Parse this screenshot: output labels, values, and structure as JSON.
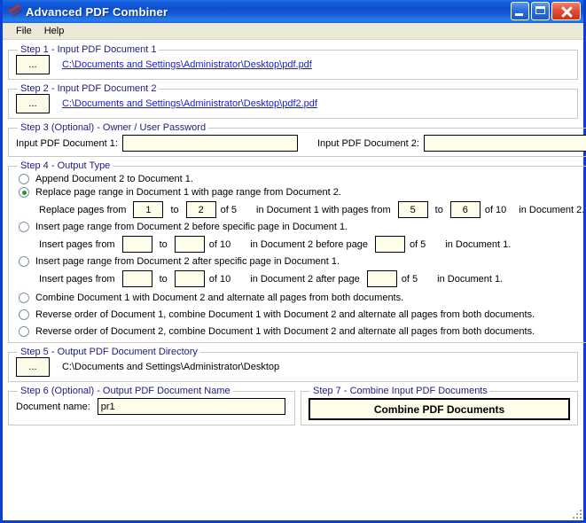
{
  "window": {
    "title": "Advanced PDF Combiner",
    "icon": "app-script-icon",
    "buttons": {
      "minimize": "Minimize",
      "maximize": "Maximize",
      "close": "Close"
    },
    "frame_color": "#0a3fd6",
    "titlebar_color": "#0d4fd0"
  },
  "menubar": {
    "items": [
      {
        "label": "File"
      },
      {
        "label": "Help"
      }
    ]
  },
  "step1": {
    "legend": "Step 1 - Input PDF Document 1",
    "browse_label": "...",
    "path": "C:\\Documents and Settings\\Administrator\\Desktop\\pdf.pdf"
  },
  "step2": {
    "legend": "Step 2 - Input PDF Document 2",
    "browse_label": "...",
    "path": "C:\\Documents and Settings\\Administrator\\Desktop\\pdf2.pdf"
  },
  "step3": {
    "legend": "Step 3 (Optional) - Owner / User Password",
    "label1": "Input PDF Document 1:",
    "value1": "",
    "placeholder1": "",
    "label2": "Input PDF Document 2:",
    "value2": "",
    "placeholder2": ""
  },
  "step4": {
    "legend": "Step 4 - Output Type",
    "options": [
      {
        "id": "append",
        "label": "Append Document 2 to Document 1.",
        "selected": false
      },
      {
        "id": "replace-range",
        "label": "Replace page range in Document 1 with page range from Document 2.",
        "selected": true
      },
      {
        "id": "insert-before",
        "label": "Insert page range from Document 2 before specific page in Document 1.",
        "selected": false
      },
      {
        "id": "insert-after",
        "label": "Insert page range from Document 2 after specific page in Document 1.",
        "selected": false
      },
      {
        "id": "combine-alternate",
        "label": "Combine Document 1 with Document 2 and alternate all pages from both documents.",
        "selected": false
      },
      {
        "id": "reverse-doc1",
        "label": "Reverse order of Document 1, combine Document 1 with Document 2 and alternate all pages from both documents.",
        "selected": false
      },
      {
        "id": "reverse-doc2",
        "label": "Reverse order of Document 2, combine Document 1 with Document 2 and alternate all pages from both documents.",
        "selected": false
      }
    ],
    "replace_row": {
      "text_from": "Replace pages from",
      "text_to": "to",
      "text_of_doc1": "of 5",
      "text_mid": "in Document 1 with pages from",
      "text_to2": "to",
      "text_of_doc2": "of 10",
      "text_end": "in Document 2.",
      "from_value": "1",
      "to_value": "2",
      "from2_value": "5",
      "to2_value": "6"
    },
    "insert_before_row": {
      "text_from": "Insert pages from",
      "text_to": "to",
      "text_of_doc2": "of 10",
      "text_mid": "in Document 2 before page",
      "text_of_doc1": "of 5",
      "text_end": "in Document 1.",
      "from_value": "",
      "to_value": "",
      "page_value": ""
    },
    "insert_after_row": {
      "text_from": "Insert pages from",
      "text_to": "to",
      "text_of_doc2": "of 10",
      "text_mid": "in Document 2 after page",
      "text_of_doc1": "of 5",
      "text_end": "in Document 1.",
      "from_value": "",
      "to_value": "",
      "page_value": ""
    }
  },
  "step5": {
    "legend": "Step 5 - Output PDF Document Directory",
    "browse_label": "...",
    "path": "C:\\Documents and Settings\\Administrator\\Desktop"
  },
  "step6": {
    "legend": "Step 6 (Optional) - Output PDF Document Name",
    "label": "Document name:",
    "value": "pr1",
    "placeholder": ""
  },
  "step7": {
    "legend": "Step 7 - Combine Input PDF Documents",
    "button_label": "Combine PDF Documents"
  }
}
